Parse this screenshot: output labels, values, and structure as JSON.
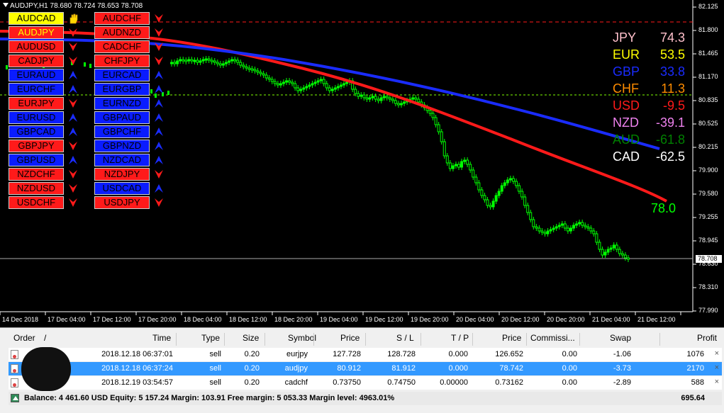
{
  "chart": {
    "title": "AUDJPY,H1  78.680 78.724 78.653 78.708",
    "price_axis": [
      "82.125",
      "81.800",
      "81.465",
      "81.170",
      "80.835",
      "80.525",
      "80.215",
      "79.900",
      "79.580",
      "79.255",
      "78.945",
      "78.630",
      "78.310",
      "77.990"
    ],
    "current_price": "78.708",
    "time_axis": [
      "14 Dec 2018",
      "17 Dec 04:00",
      "17 Dec 12:00",
      "17 Dec 20:00",
      "18 Dec 04:00",
      "18 Dec 12:00",
      "18 Dec 20:00",
      "19 Dec 04:00",
      "19 Dec 12:00",
      "19 Dec 20:00",
      "20 Dec 04:00",
      "20 Dec 12:00",
      "20 Dec 20:00",
      "21 Dec 04:00",
      "21 Dec 12:00"
    ],
    "indicator_value": "78.0",
    "colors": {
      "bull": "#00ff00",
      "bear": "#00ff00",
      "ma_red": "#ff1a1a",
      "ma_blue": "#1a2cff",
      "grid": "#444444"
    }
  },
  "pairs_left": [
    {
      "label": "AUDCAD",
      "style": "yellow",
      "icon": "hand-icon"
    },
    {
      "label": "AUDJPY",
      "style": "red-yellowtext",
      "icon": "arrow-down-icon"
    },
    {
      "label": "AUDUSD",
      "style": "red",
      "icon": "arrow-down-icon"
    },
    {
      "label": "CADJPY",
      "style": "red",
      "icon": "arrow-down-icon"
    },
    {
      "label": "EURAUD",
      "style": "blue",
      "icon": "arrow-up-icon"
    },
    {
      "label": "EURCHF",
      "style": "blue",
      "icon": "arrow-up-icon"
    },
    {
      "label": "EURJPY",
      "style": "red",
      "icon": "arrow-down-icon"
    },
    {
      "label": "EURUSD",
      "style": "blue",
      "icon": "arrow-up-icon"
    },
    {
      "label": "GBPCAD",
      "style": "blue",
      "icon": "arrow-up-icon"
    },
    {
      "label": "GBPJPY",
      "style": "red",
      "icon": "arrow-down-icon"
    },
    {
      "label": "GBPUSD",
      "style": "blue",
      "icon": "arrow-up-icon"
    },
    {
      "label": "NZDCHF",
      "style": "red",
      "icon": "arrow-down-icon"
    },
    {
      "label": "NZDUSD",
      "style": "red",
      "icon": "arrow-down-icon"
    },
    {
      "label": "USDCHF",
      "style": "red",
      "icon": "arrow-down-icon"
    }
  ],
  "pairs_right": [
    {
      "label": "AUDCHF",
      "style": "red",
      "icon": "arrow-down-icon"
    },
    {
      "label": "AUDNZD",
      "style": "red",
      "icon": "arrow-down-icon"
    },
    {
      "label": "CADCHF",
      "style": "red",
      "icon": "arrow-down-icon"
    },
    {
      "label": "CHFJPY",
      "style": "red",
      "icon": "arrow-down-icon"
    },
    {
      "label": "EURCAD",
      "style": "blue",
      "icon": "arrow-up-icon"
    },
    {
      "label": "EURGBP",
      "style": "blue",
      "icon": "arrow-up-icon"
    },
    {
      "label": "EURNZD",
      "style": "blue",
      "icon": "arrow-up-icon"
    },
    {
      "label": "GBPAUD",
      "style": "blue",
      "icon": "arrow-up-icon"
    },
    {
      "label": "GBPCHF",
      "style": "blue",
      "icon": "arrow-up-icon"
    },
    {
      "label": "GBPNZD",
      "style": "blue",
      "icon": "arrow-up-icon"
    },
    {
      "label": "NZDCAD",
      "style": "blue",
      "icon": "arrow-up-icon"
    },
    {
      "label": "NZDJPY",
      "style": "red",
      "icon": "arrow-down-icon"
    },
    {
      "label": "USDCAD",
      "style": "blue",
      "icon": "arrow-up-icon"
    },
    {
      "label": "USDJPY",
      "style": "red",
      "icon": "arrow-down-icon"
    }
  ],
  "strength": [
    {
      "currency": "JPY",
      "value": "74.3",
      "color": "#ffc0cb"
    },
    {
      "currency": "EUR",
      "value": "53.5",
      "color": "#ffff00"
    },
    {
      "currency": "GBP",
      "value": "33.8",
      "color": "#1a2cff"
    },
    {
      "currency": "CHF",
      "value": "11.3",
      "color": "#ff8c00"
    },
    {
      "currency": "USD",
      "value": "-9.5",
      "color": "#ff1a1a"
    },
    {
      "currency": "NZD",
      "value": "-39.1",
      "color": "#ee82ee"
    },
    {
      "currency": "AUD",
      "value": "-61.8",
      "color": "#008000"
    },
    {
      "currency": "CAD",
      "value": "-62.5",
      "color": "#ffffff"
    }
  ],
  "terminal": {
    "headers": [
      "Order",
      "/",
      "Time",
      "Type",
      "Size",
      "Symbol",
      "Price",
      "S / L",
      "T / P",
      "Price",
      "Commissi...",
      "Swap",
      "Profit"
    ],
    "rows": [
      {
        "time": "2018.12.18 06:37:01",
        "type": "sell",
        "size": "0.20",
        "symbol": "eurjpy",
        "price": "127.728",
        "sl": "128.728",
        "tp": "0.000",
        "cur_price": "126.652",
        "commission": "0.00",
        "swap": "-1.06",
        "profit": "1076",
        "selected": false
      },
      {
        "time": "2018.12.18 06:37:24",
        "type": "sell",
        "size": "0.20",
        "symbol": "audjpy",
        "price": "80.912",
        "sl": "81.912",
        "tp": "0.000",
        "cur_price": "78.742",
        "commission": "0.00",
        "swap": "-3.73",
        "profit": "2170",
        "selected": true
      },
      {
        "time": "2018.12.19 03:54:57",
        "type": "sell",
        "size": "0.20",
        "symbol": "cadchf",
        "price": "0.73750",
        "sl": "0.74750",
        "tp": "0.00000",
        "cur_price": "0.73162",
        "commission": "0.00",
        "swap": "-2.89",
        "profit": "588",
        "selected": false
      }
    ],
    "balance_text": "Balance: 4 461.60 USD  Equity: 5 157.24  Margin: 103.91  Free margin: 5 053.33  Margin level: 4963.01%",
    "total_profit": "695.64",
    "close_symbol": "×"
  }
}
